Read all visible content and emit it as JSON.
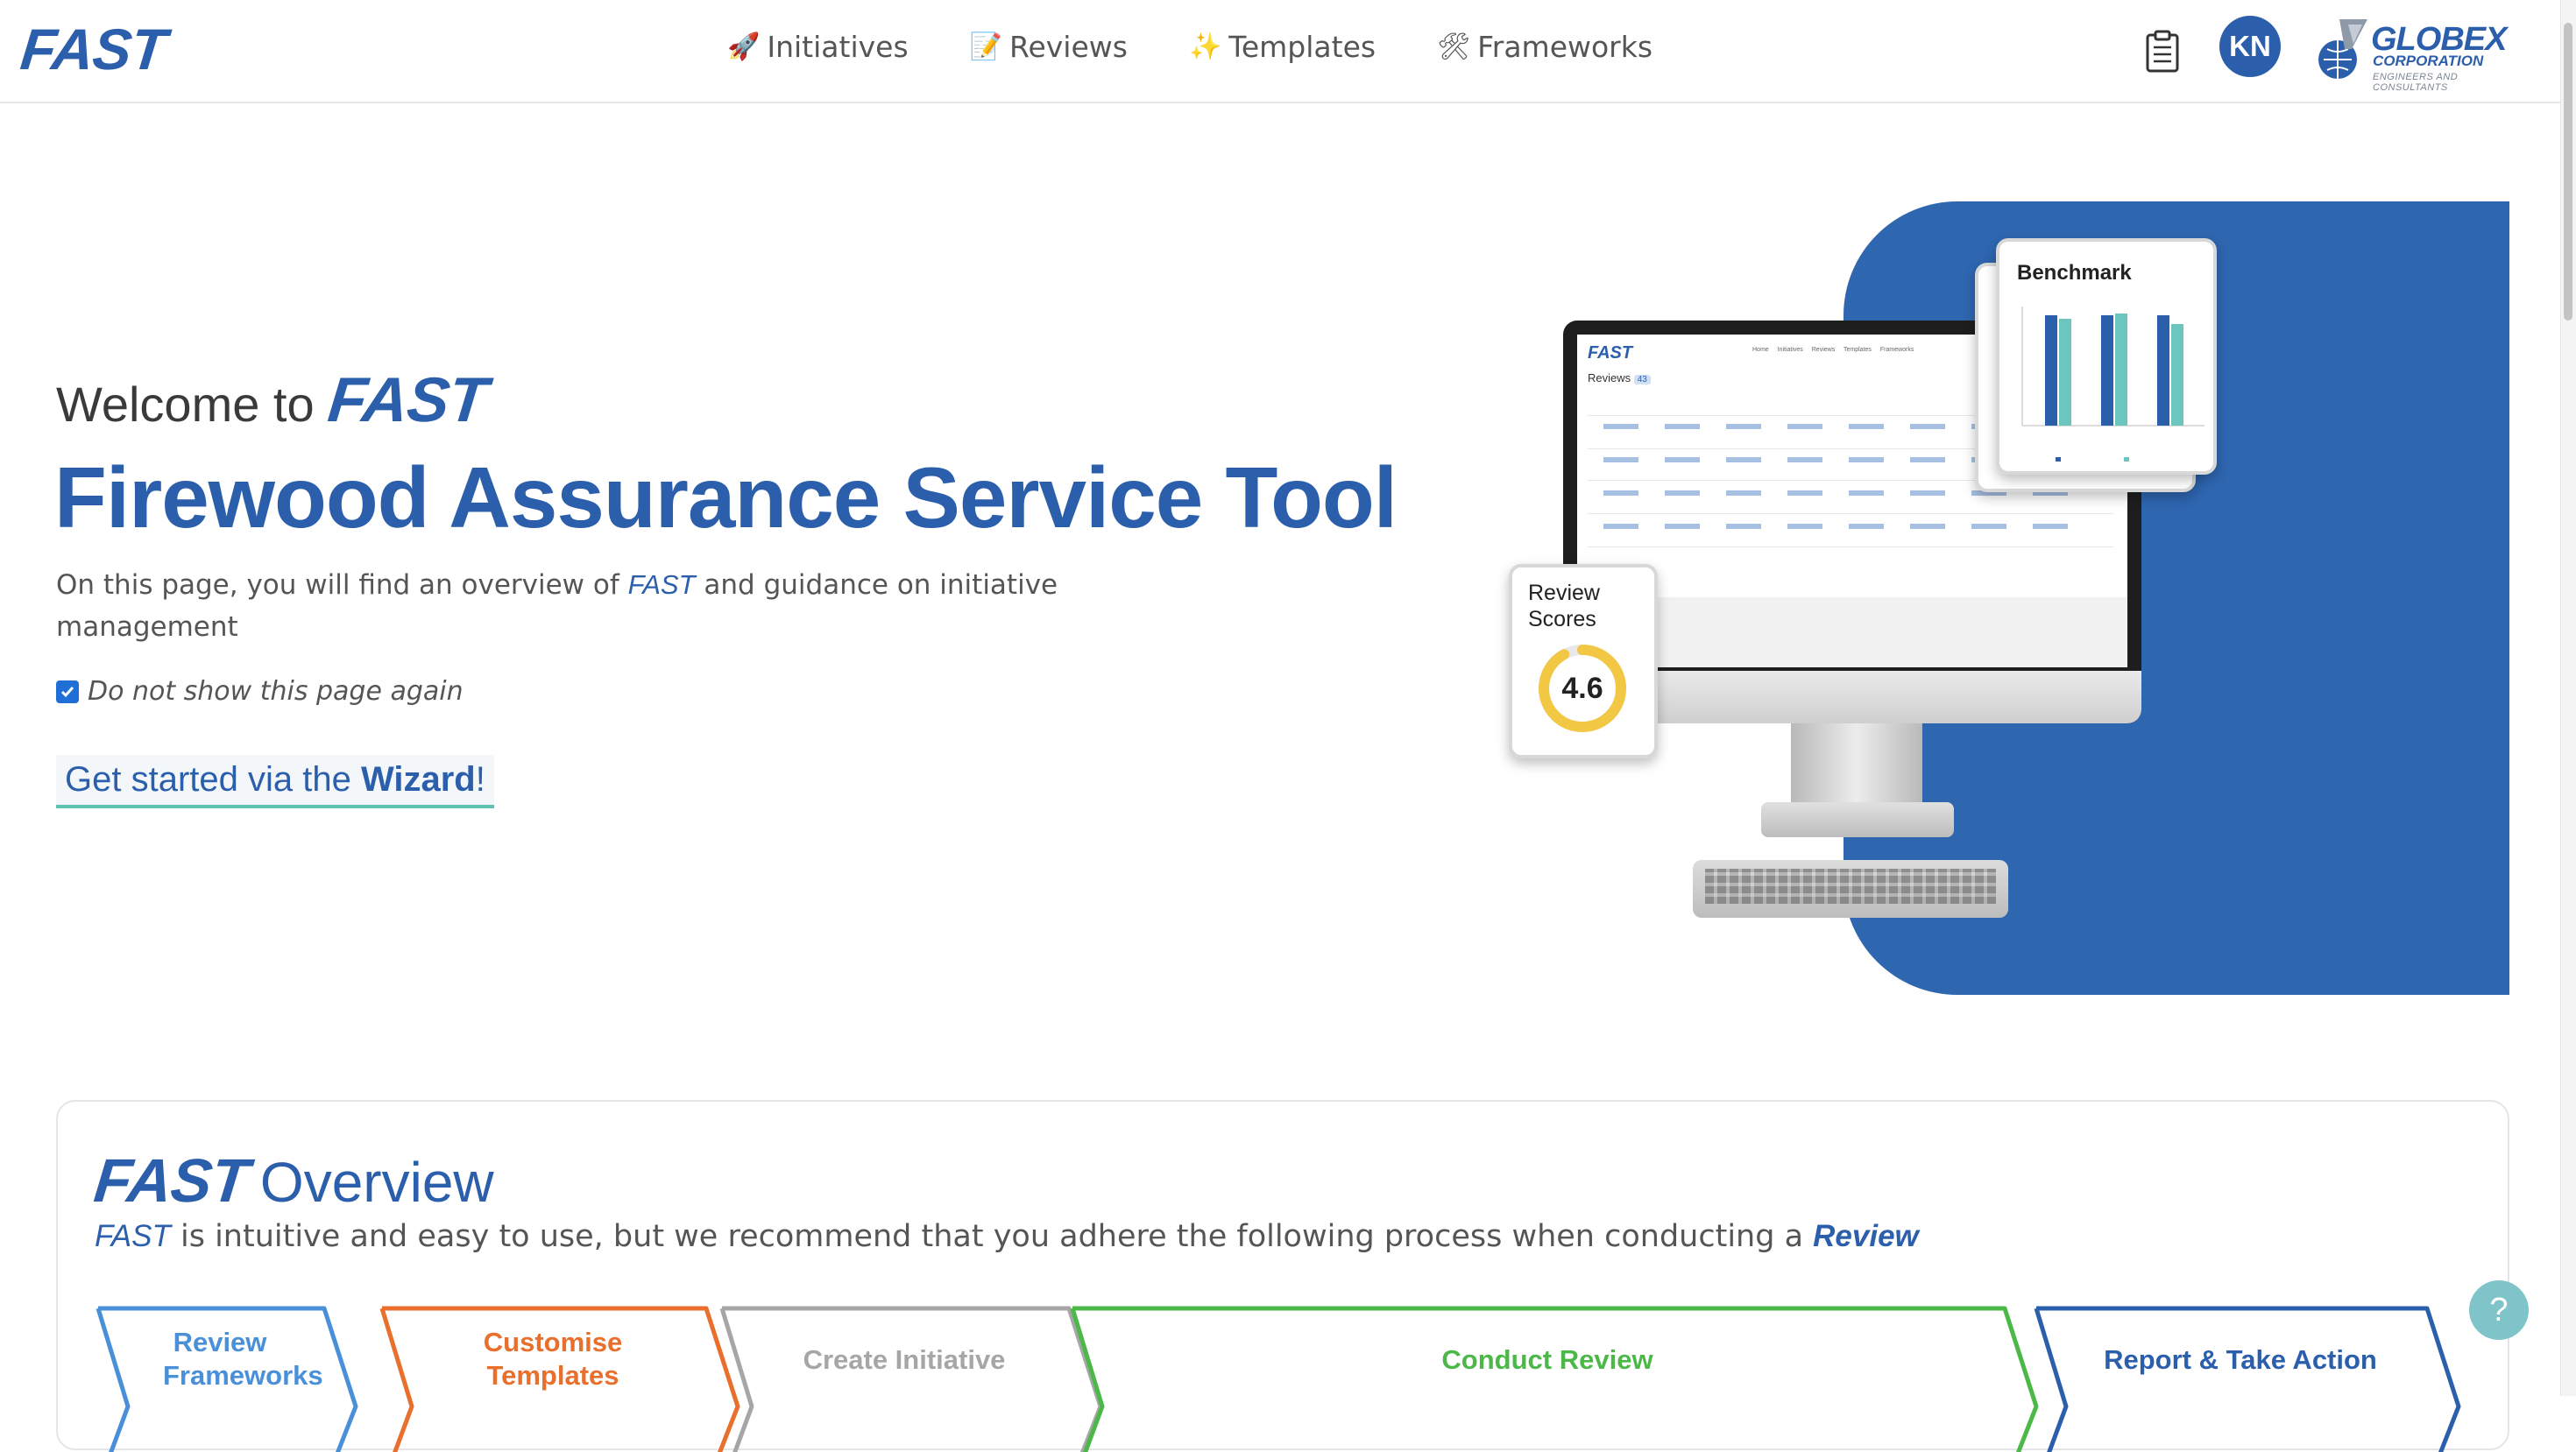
{
  "app": {
    "logo": "FAST"
  },
  "nav": {
    "items": [
      {
        "icon": "🚀",
        "icon_name": "rocket-icon",
        "label": "Initiatives"
      },
      {
        "icon": "📝",
        "icon_name": "memo-icon",
        "label": "Reviews"
      },
      {
        "icon": "✨",
        "icon_name": "sparkles-icon",
        "label": "Templates"
      },
      {
        "icon": "🛠",
        "icon_name": "tools-icon",
        "label": "Frameworks"
      }
    ]
  },
  "user": {
    "initials": "KN"
  },
  "company": {
    "name": "GLOBEX",
    "sub": "CORPORATION",
    "tagline": "ENGINEERS AND CONSULTANTS"
  },
  "hero": {
    "welcome": "Welcome to",
    "brand": "FAST",
    "title": "Firewood Assurance Service Tool",
    "desc_pre": "On this page, you will find an overview of ",
    "desc_brand": "FAST",
    "desc_post": " and guidance on initiative management",
    "checkbox_label": "Do not show this page again",
    "checkbox_checked": true,
    "wizard_pre": "Get started via the ",
    "wizard_bold": "Wizard",
    "wizard_post": "!"
  },
  "illustration": {
    "benchmark_title": "Benchmark",
    "scores_title_1": "Review",
    "scores_title_2": "Scores",
    "score_value": "4.6",
    "score_fraction": 0.92,
    "screen_logo": "FAST",
    "screen_title": "Reviews",
    "screen_count": "43",
    "screen_nav": "Home Initiatives Reviews Templates Frameworks"
  },
  "overview": {
    "brand": "FAST",
    "title": "Overview",
    "desc_brand": "FAST",
    "desc_mid": " is intuitive and easy to use, but we recommend that you adhere the following process when conducting a ",
    "desc_link": "Review",
    "steps": [
      {
        "label": "Review Frameworks",
        "color": "#4a90d9"
      },
      {
        "label": "Customise Templates",
        "color": "#e86f2c"
      },
      {
        "label": "Create Initiative",
        "color": "#a6a6a6"
      },
      {
        "label": "Conduct Review",
        "color": "#4cb848"
      },
      {
        "label": "Report & Take Action",
        "color": "#2c5fab"
      }
    ]
  },
  "help": {
    "label": "?"
  },
  "colors": {
    "brand": "#2c5fab",
    "accent": "#5fc2b1",
    "panel": "#2e66b0"
  }
}
